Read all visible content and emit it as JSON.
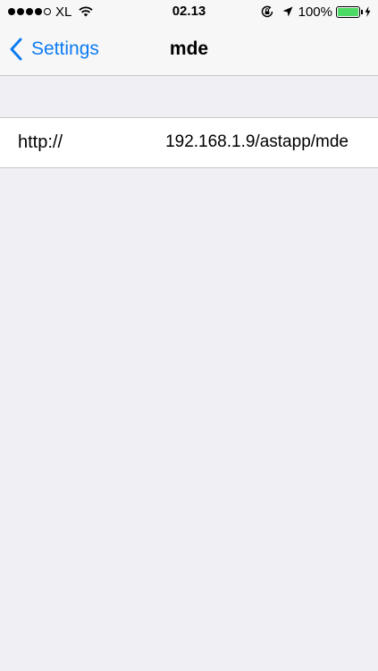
{
  "status_bar": {
    "carrier": "XL",
    "time": "02.13",
    "battery_percent": "100%",
    "signal": {
      "filled_dots": 4,
      "total_dots": 5
    },
    "icons": [
      "signal-dots-icon",
      "wifi-icon",
      "rotation-lock-icon",
      "location-arrow-icon",
      "battery-icon",
      "charging-bolt-icon"
    ],
    "battery_color": "#4cd964"
  },
  "nav": {
    "back_label": "Settings",
    "title": "mde",
    "tint_color": "#0d7cf2"
  },
  "settings": {
    "url_label": "http://",
    "url_value": "192.168.1.9/astapp/mde"
  }
}
